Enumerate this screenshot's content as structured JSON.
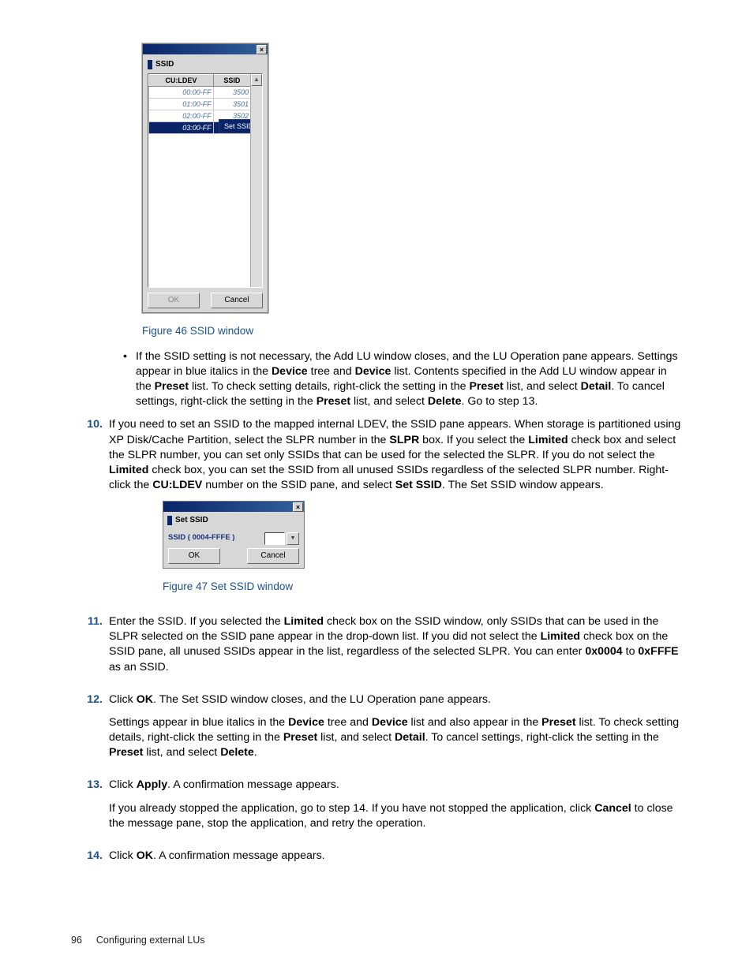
{
  "dlg1": {
    "title": "SSID",
    "col1": "CU:LDEV",
    "col2": "SSID",
    "rows": [
      {
        "c1": "00:00-FF",
        "c2": "3500"
      },
      {
        "c1": "01:00-FF",
        "c2": "3501"
      },
      {
        "c1": "02:00-FF",
        "c2": "3502"
      }
    ],
    "selrow": {
      "c1": "03:00-FF",
      "c2": ""
    },
    "ctx": "Set SSID...",
    "ok": "OK",
    "cancel": "Cancel"
  },
  "fig46": "Figure 46 SSID window",
  "bullet": {
    "a": "If the SSID setting is not necessary, the Add LU window closes, and the LU Operation pane appears. Settings appear in blue italics in the ",
    "b": " tree and ",
    "c": " list. Contents specified in the Add LU window appear in the ",
    "d": " list. To check setting details, right-click the setting in the ",
    "e": " list, and select ",
    "f": ". To cancel settings, right-click the setting in the ",
    "g": " list, and select ",
    "h": ". Go to step 13."
  },
  "kw": {
    "Device": "Device",
    "Preset": "Preset",
    "Detail": "Detail",
    "Delete": "Delete",
    "Limited": "Limited",
    "SLPR": "SLPR",
    "CULDEV": "CU:LDEV",
    "SetSSID": "Set SSID",
    "OK": "OK",
    "Apply": "Apply",
    "Cancel": "Cancel",
    "hex1": "0x0004",
    "hex2": "0xFFFE"
  },
  "s10": {
    "n": "10.",
    "a": "If you need to set an SSID to the mapped internal LDEV, the SSID pane appears. When storage is partitioned using XP Disk/Cache Partition, select the SLPR number in the ",
    "b": " box. If you select the ",
    "c": " check box and select the SLPR number, you can set only SSIDs that can be used for the selected the SLPR. If you do not select the ",
    "d": " check box, you can set the SSID from all unused SSIDs regardless of the selected SLPR number. Right-click the ",
    "e": " number on the SSID pane, and select ",
    "f": ". The Set SSID window appears."
  },
  "dlg2": {
    "title": "Set SSID",
    "label": "SSID ( 0004-FFFE )",
    "ok": "OK",
    "cancel": "Cancel"
  },
  "fig47": "Figure 47 Set SSID window",
  "s11": {
    "n": "11.",
    "a": "Enter the SSID. If you selected the ",
    "b": " check box on the SSID window, only SSIDs that can be used in the SLPR selected on the SSID pane appear in the drop-down list. If you did not select the ",
    "c": " check box on the SSID pane, all unused SSIDs appear in the list, regardless of the selected SLPR. You can enter ",
    "d": " to ",
    "e": " as an SSID."
  },
  "s12": {
    "n": "12.",
    "a": "Click ",
    "b": ". The Set SSID window closes, and the LU Operation pane appears.",
    "p2a": "Settings appear in blue italics in the ",
    "p2b": " tree and ",
    "p2c": " list and also appear in the ",
    "p2d": " list. To check setting details, right-click the setting in the ",
    "p2e": " list, and select ",
    "p2f": ". To cancel settings, right-click the setting in the ",
    "p2g": " list, and select ",
    "p2h": "."
  },
  "s13": {
    "n": "13.",
    "a": "Click ",
    "b": ". A confirmation message appears.",
    "p2a": "If you already stopped the application, go to step 14. If you have not stopped the application, click ",
    "p2b": " to close the message pane, stop the application, and retry the operation."
  },
  "s14": {
    "n": "14.",
    "a": "Click ",
    "b": ". A confirmation message appears."
  },
  "footer": {
    "pg": "96",
    "section": "Configuring external LUs"
  }
}
